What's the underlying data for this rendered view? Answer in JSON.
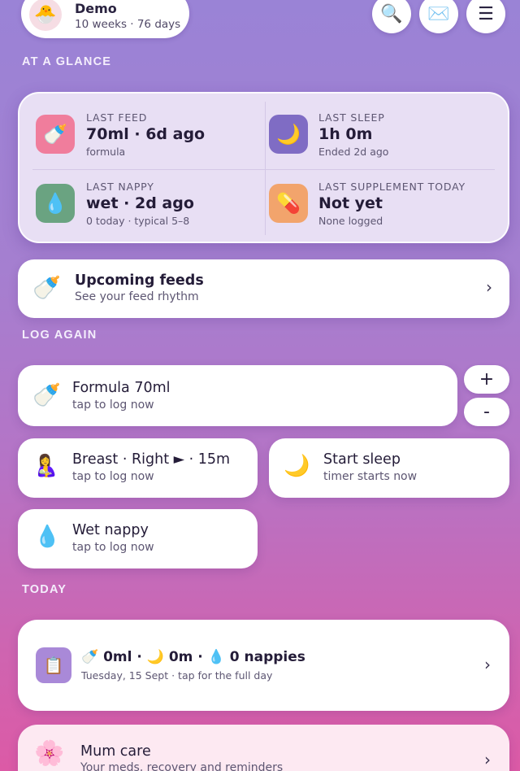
{
  "profile": {
    "avatar_icon": "chick-emoji",
    "avatar_glyph": "🐣",
    "name": "Demo",
    "age": "10 weeks · 76 days"
  },
  "header_buttons": {
    "search_glyph": "🔍",
    "inbox_glyph": "✉️",
    "menu_glyph": "☰"
  },
  "at_a_glance": {
    "section_label": "AT A GLANCE",
    "last_feed": {
      "label": "LAST FEED",
      "value": "70ml · 6d ago",
      "sub": "formula",
      "glyph": "🍼",
      "color": "#f07d9c"
    },
    "last_sleep": {
      "label": "LAST SLEEP",
      "value": "1h 0m",
      "sub": "Ended 2d ago",
      "glyph": "🌙",
      "color": "#7f6cc4"
    },
    "last_nappy": {
      "label": "LAST NAPPY",
      "value": "wet · 2d ago",
      "sub": "0 today · typical 5–8",
      "glyph": "💧",
      "color": "#6aa381"
    },
    "last_supplement": {
      "label": "LAST SUPPLEMENT TODAY",
      "value": "Not yet",
      "sub": "None logged",
      "glyph": "💊",
      "color": "#f2a46c"
    }
  },
  "upcoming_feeds": {
    "glyph": "🍼",
    "title": "Upcoming feeds",
    "sub": "See your feed rhythm",
    "chevron": "›"
  },
  "log_again": {
    "section_label": "LOG AGAIN",
    "formula": {
      "glyph": "🍼",
      "title": "Formula 70ml",
      "sub": "tap to log now"
    },
    "plus_label": "+",
    "minus_label": "-",
    "breast": {
      "glyph": "🤱",
      "title": "Breast · Right ► · 15m",
      "sub": "tap to log now"
    },
    "sleep": {
      "glyph": "🌙",
      "title": "Start sleep",
      "sub": "timer starts now"
    },
    "wet_nappy": {
      "glyph": "💧",
      "title": "Wet nappy",
      "sub": "tap to log now"
    }
  },
  "today": {
    "section_label": "TODAY",
    "icon_glyph": "📋",
    "stats": "🍼 0ml · 🌙 0m · 💧 0 nappies",
    "sub": "Tuesday, 15 Sept · tap for the full day",
    "chevron": "›"
  },
  "mum_care": {
    "glyph": "🌸",
    "title": "Mum care",
    "sub": "Your meds, recovery and reminders",
    "chevron": "›"
  }
}
